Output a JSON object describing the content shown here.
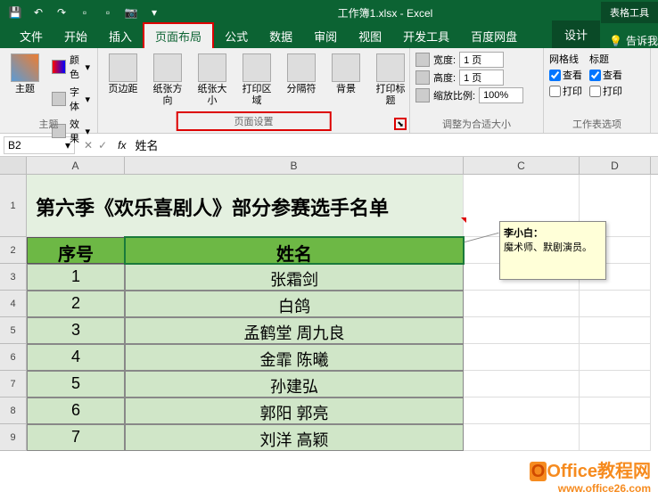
{
  "titlebar": {
    "title": "工作簿1.xlsx - Excel",
    "table_tools": "表格工具"
  },
  "tabs": {
    "file": "文件",
    "home": "开始",
    "insert": "插入",
    "page_layout": "页面布局",
    "formulas": "公式",
    "data": "数据",
    "review": "审阅",
    "view": "视图",
    "developer": "开发工具",
    "baidu": "百度网盘",
    "design": "设计",
    "tell_me": "告诉我"
  },
  "ribbon": {
    "themes": {
      "main": "主题",
      "colors": "颜色",
      "fonts": "字体",
      "effects": "效果",
      "group": "主题"
    },
    "page_setup": {
      "margins": "页边距",
      "orientation": "纸张方向",
      "size": "纸张大小",
      "print_area": "打印区域",
      "breaks": "分隔符",
      "background": "背景",
      "print_titles": "打印标题",
      "group": "页面设置"
    },
    "scale": {
      "width_lbl": "宽度:",
      "width_val": "1 页",
      "height_lbl": "高度:",
      "height_val": "1 页",
      "scale_lbl": "缩放比例:",
      "scale_val": "100%",
      "group": "调整为合适大小"
    },
    "sheet_options": {
      "gridlines": "网格线",
      "headings": "标题",
      "view": "查看",
      "print": "打印",
      "group": "工作表选项"
    }
  },
  "formula_bar": {
    "name_box": "B2",
    "formula": "姓名"
  },
  "columns": [
    "A",
    "B",
    "C",
    "D"
  ],
  "sheet": {
    "title": "第六季《欢乐喜剧人》部分参赛选手名单",
    "header_a": "序号",
    "header_b": "姓名",
    "rows": [
      {
        "n": "1",
        "name": "张霜剑"
      },
      {
        "n": "2",
        "name": "白鸽"
      },
      {
        "n": "3",
        "name": "孟鹤堂  周九良"
      },
      {
        "n": "4",
        "name": "金霏  陈曦"
      },
      {
        "n": "5",
        "name": "孙建弘"
      },
      {
        "n": "6",
        "name": "郭阳  郭亮"
      },
      {
        "n": "7",
        "name": "刘洋  高颖"
      }
    ]
  },
  "comment": {
    "author": "李小白：",
    "text": "魔术师、默剧演员。"
  },
  "watermark": {
    "brand": "Office教程网",
    "url": "www.office26.com"
  }
}
